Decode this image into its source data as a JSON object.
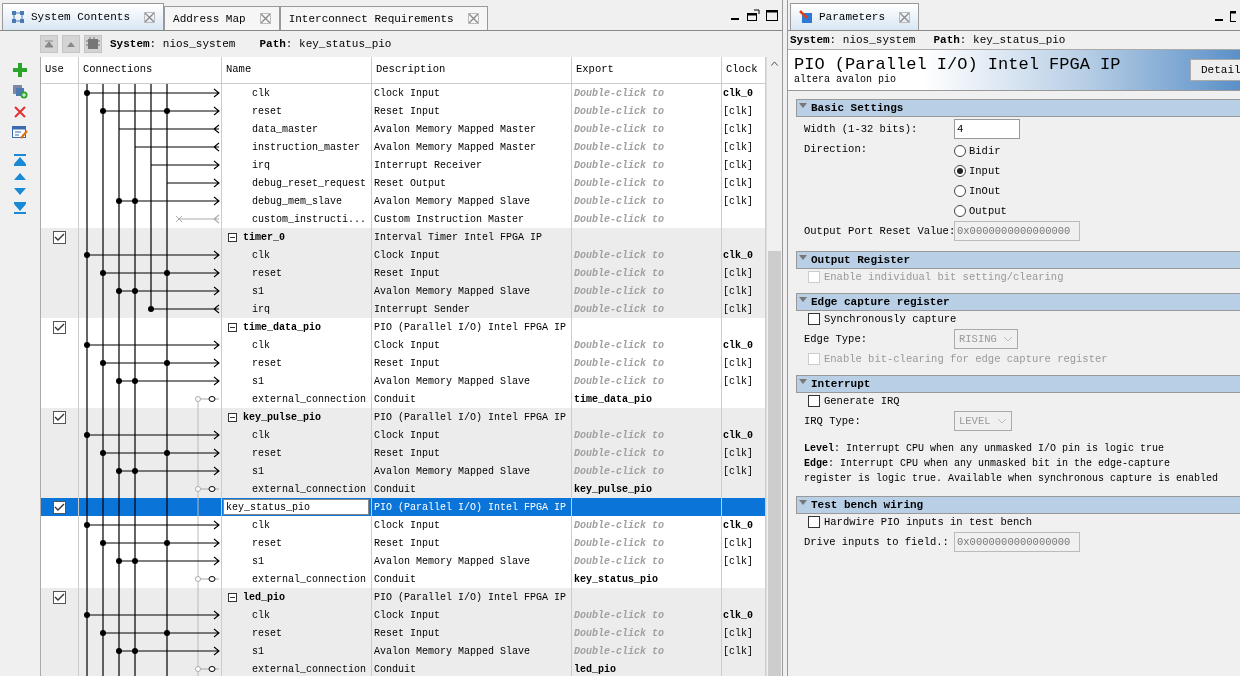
{
  "tabs": [
    {
      "label": "System Contents",
      "selected": true
    },
    {
      "label": "Address Map",
      "selected": false
    },
    {
      "label": "Interconnect Requirements",
      "selected": false
    }
  ],
  "toolbar": {
    "system": "**System**: nios_system",
    "path": "**Path**: key_status_pio"
  },
  "table": {
    "columns": [
      "Use",
      "Connections",
      "Name",
      "Description",
      "Export",
      "Clock"
    ],
    "components": [
      {
        "ports": [
          {
            "name": "clk",
            "description": "Clock Input",
            "export": "Double-click to",
            "exported": false,
            "clock": "clk_0",
            "kind": "clock"
          },
          {
            "name": "reset",
            "description": "Reset Input",
            "export": "Double-click to",
            "exported": false,
            "clock": "[clk]",
            "kind": "reset"
          },
          {
            "name": "data_master",
            "description": "Avalon Memory Mapped Master",
            "export": "Double-click to",
            "exported": false,
            "clock": "[clk]",
            "kind": "master"
          },
          {
            "name": "instruction_master",
            "description": "Avalon Memory Mapped Master",
            "export": "Double-click to",
            "exported": false,
            "clock": "[clk]",
            "kind": "master"
          },
          {
            "name": "irq",
            "description": "Interrupt Receiver",
            "export": "Double-click to",
            "exported": false,
            "clock": "[clk]",
            "kind": "irq_receiver"
          },
          {
            "name": "debug_reset_request",
            "description": "Reset Output",
            "export": "Double-click to",
            "exported": false,
            "clock": "[clk]",
            "kind": "reset_output"
          },
          {
            "name": "debug_mem_slave",
            "description": "Avalon Memory Mapped Slave",
            "export": "Double-click to",
            "exported": false,
            "clock": "[clk]",
            "kind": "slave"
          },
          {
            "name": "custom_instructi...",
            "description": "Custom Instruction Master",
            "export": "Double-click to",
            "exported": false,
            "kind": "custom"
          }
        ]
      },
      {
        "name": "timer_0",
        "description": "Interval Timer Intel FPGA IP",
        "use": true,
        "expanded": true,
        "selected": false,
        "editing": false,
        "ports": [
          {
            "name": "clk",
            "description": "Clock Input",
            "export": "Double-click to",
            "exported": false,
            "clock": "clk_0",
            "kind": "clock"
          },
          {
            "name": "reset",
            "description": "Reset Input",
            "export": "Double-click to",
            "exported": false,
            "clock": "[clk]",
            "kind": "reset"
          },
          {
            "name": "s1",
            "description": "Avalon Memory Mapped Slave",
            "export": "Double-click to",
            "exported": false,
            "clock": "[clk]",
            "kind": "slave"
          },
          {
            "name": "irq",
            "description": "Interrupt Sender",
            "export": "Double-click to",
            "exported": false,
            "clock": "[clk]",
            "kind": "irq_sender"
          }
        ]
      },
      {
        "name": "time_data_pio",
        "description": "PIO (Parallel I/O) Intel FPGA IP",
        "use": true,
        "expanded": true,
        "selected": false,
        "editing": false,
        "ports": [
          {
            "name": "clk",
            "description": "Clock Input",
            "export": "Double-click to",
            "exported": false,
            "clock": "clk_0",
            "kind": "clock"
          },
          {
            "name": "reset",
            "description": "Reset Input",
            "export": "Double-click to",
            "exported": false,
            "clock": "[clk]",
            "kind": "reset"
          },
          {
            "name": "s1",
            "description": "Avalon Memory Mapped Slave",
            "export": "Double-click to",
            "exported": false,
            "clock": "[clk]",
            "kind": "slave"
          },
          {
            "name": "external_connection",
            "description": "Conduit",
            "export": "time_data_pio",
            "exported": true,
            "kind": "conduit"
          }
        ]
      },
      {
        "name": "key_pulse_pio",
        "description": "PIO (Parallel I/O) Intel FPGA IP",
        "use": true,
        "expanded": true,
        "selected": false,
        "editing": false,
        "ports": [
          {
            "name": "clk",
            "description": "Clock Input",
            "export": "Double-click to",
            "exported": false,
            "clock": "clk_0",
            "kind": "clock"
          },
          {
            "name": "reset",
            "description": "Reset Input",
            "export": "Double-click to",
            "exported": false,
            "clock": "[clk]",
            "kind": "reset"
          },
          {
            "name": "s1",
            "description": "Avalon Memory Mapped Slave",
            "export": "Double-click to",
            "exported": false,
            "clock": "[clk]",
            "kind": "slave"
          },
          {
            "name": "external_connection",
            "description": "Conduit",
            "export": "key_pulse_pio",
            "exported": true,
            "kind": "conduit"
          }
        ]
      },
      {
        "name": "key_status_pio",
        "description": "PIO (Parallel I/O) Intel FPGA IP",
        "use": true,
        "expanded": true,
        "selected": true,
        "editing": true,
        "ports": [
          {
            "name": "clk",
            "description": "Clock Input",
            "export": "Double-click to",
            "exported": false,
            "clock": "clk_0",
            "kind": "clock"
          },
          {
            "name": "reset",
            "description": "Reset Input",
            "export": "Double-click to",
            "exported": false,
            "clock": "[clk]",
            "kind": "reset"
          },
          {
            "name": "s1",
            "description": "Avalon Memory Mapped Slave",
            "export": "Double-click to",
            "exported": false,
            "clock": "[clk]",
            "kind": "slave"
          },
          {
            "name": "external_connection",
            "description": "Conduit",
            "export": "key_status_pio",
            "exported": true,
            "kind": "conduit"
          }
        ]
      },
      {
        "name": "led_pio",
        "description": "PIO (Parallel I/O) Intel FPGA IP",
        "use": true,
        "expanded": true,
        "selected": false,
        "editing": false,
        "ports": [
          {
            "name": "clk",
            "description": "Clock Input",
            "export": "Double-click to",
            "exported": false,
            "clock": "clk_0",
            "kind": "clock"
          },
          {
            "name": "reset",
            "description": "Reset Input",
            "export": "Double-click to",
            "exported": false,
            "clock": "[clk]",
            "kind": "reset"
          },
          {
            "name": "s1",
            "description": "Avalon Memory Mapped Slave",
            "export": "Double-click to",
            "exported": false,
            "clock": "[clk]",
            "kind": "slave"
          },
          {
            "name": "external_connection",
            "description": "Conduit",
            "export": "led_pio",
            "exported": true,
            "kind": "conduit"
          }
        ]
      }
    ]
  },
  "parameters": {
    "tab": {
      "label": "Parameters",
      "selected": true
    },
    "system": "**System**: nios_system",
    "path": "**Path**: key_status_pio",
    "title": "PIO (Parallel I/O) Intel FPGA IP",
    "subtitle": "altera avalon pio",
    "details_button": "Detail",
    "sections": [
      {
        "title": "Basic Settings",
        "expanded": true,
        "items": [
          {
            "kind": "field",
            "label": "Width (1-32 bits):",
            "value": "4",
            "disabled": false
          },
          {
            "kind": "radio_group",
            "label": "Direction:",
            "options": [
              {
                "label": "Bidir",
                "selected": false
              },
              {
                "label": "Input",
                "selected": true
              },
              {
                "label": "InOut",
                "selected": false
              },
              {
                "label": "Output",
                "selected": false
              }
            ]
          },
          {
            "kind": "field",
            "label": "Output Port Reset Value:",
            "value": "0x0000000000000000",
            "disabled": true
          }
        ]
      },
      {
        "title": "Output Register",
        "expanded": true,
        "items": [
          {
            "kind": "checkbox",
            "label": "Enable individual bit setting/clearing",
            "checked": false,
            "disabled": true
          }
        ]
      },
      {
        "title": "Edge capture register",
        "expanded": true,
        "items": [
          {
            "kind": "checkbox",
            "label": "Synchronously capture",
            "checked": false,
            "disabled": false
          },
          {
            "kind": "select",
            "label": "Edge Type:",
            "value": "RISING",
            "disabled": true
          },
          {
            "kind": "checkbox",
            "label": "Enable bit-clearing for edge capture register",
            "checked": false,
            "disabled": true
          }
        ]
      },
      {
        "title": "Interrupt",
        "expanded": true,
        "items": [
          {
            "kind": "checkbox",
            "label": "Generate IRQ",
            "checked": false,
            "disabled": false
          },
          {
            "kind": "select",
            "label": "IRQ Type:",
            "value": "LEVEL",
            "disabled": true
          },
          {
            "kind": "note",
            "lines": [
              "**Level**: Interrupt CPU when any unmasked I/O pin is logic true",
              "**Edge**: Interrupt CPU when any unmasked bit in the edge-capture register is logic true. Available when synchronous capture is enabled"
            ]
          }
        ]
      },
      {
        "title": "Test bench wiring",
        "expanded": true,
        "items": [
          {
            "kind": "checkbox",
            "label": "Hardwire PIO inputs in test bench",
            "checked": false,
            "disabled": false
          },
          {
            "kind": "field",
            "label": "Drive inputs to field.:",
            "value": "0x0000000000000000",
            "disabled": true
          }
        ]
      }
    ]
  }
}
